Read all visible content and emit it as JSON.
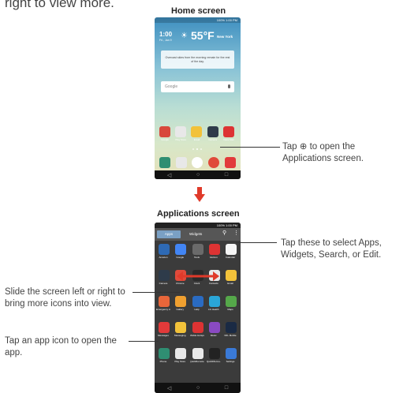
{
  "intro_text": "right to view more.",
  "home": {
    "caption": "Home screen",
    "status": "100% 1:00 PM",
    "weather": {
      "time": "1:00",
      "ampm": "PM",
      "date": "Fri., Jan 9",
      "temp": "55°F",
      "city": "New York",
      "description": "Overcast skies from the morning remain for the rest of the day."
    },
    "search_placeholder": "Google",
    "app_icons": [
      {
        "label": "Google",
        "color": "#d8483b"
      },
      {
        "label": "Play Store",
        "color": "#e8e8e8"
      },
      {
        "label": "Email",
        "color": "#f2c23a"
      },
      {
        "label": "Camera",
        "color": "#2e3b4a"
      },
      {
        "label": "Voice Mail",
        "color": "#d33"
      }
    ],
    "dock_icons": [
      {
        "label": "Phone",
        "color": "#2f8e72"
      },
      {
        "label": "Contacts",
        "color": "#e8e8e8"
      },
      {
        "label": "Apps",
        "color": "#ffffff"
      },
      {
        "label": "Chrome",
        "color": "#e04a3a"
      },
      {
        "label": "Messaging",
        "color": "#e23a3a"
      }
    ],
    "callout": "Tap ⊕ to open the Applications screen."
  },
  "apps_screen": {
    "caption": "Applications screen",
    "status": "100% 1:00 PM",
    "tab_apps": "Apps",
    "tab_widgets": "Widgets",
    "grid": [
      [
        {
          "label": "Amazon",
          "color": "#2e6ab5"
        },
        {
          "label": "Google",
          "color": "#4285f4"
        },
        {
          "label": "Tools",
          "color": "#6a6a6a"
        },
        {
          "label": "Verizon",
          "color": "#d33"
        },
        {
          "label": "Calendar",
          "color": "#f5f5f5"
        }
      ],
      [
        {
          "label": "Camera",
          "color": "#2e3b4a"
        },
        {
          "label": "Chrome",
          "color": "#e04a3a"
        },
        {
          "label": "Clock",
          "color": "#2a2a2a"
        },
        {
          "label": "Contacts",
          "color": "#e8e8e8"
        },
        {
          "label": "Email",
          "color": "#f2c23a"
        }
      ],
      [
        {
          "label": "Emergency Alerts",
          "color": "#e8663a"
        },
        {
          "label": "Gallery",
          "color": "#f0a030"
        },
        {
          "label": "Help",
          "color": "#2a6bc2"
        },
        {
          "label": "LG Health",
          "color": "#2aa6d8"
        },
        {
          "label": "Maps",
          "color": "#55a84a"
        }
      ],
      [
        {
          "label": "Messages",
          "color": "#e23a3a"
        },
        {
          "label": "Messaging",
          "color": "#f2c23a"
        },
        {
          "label": "Mobile Hotspot",
          "color": "#d33"
        },
        {
          "label": "Music",
          "color": "#8a4ac2"
        },
        {
          "label": "NFL Mobile",
          "color": "#1a2a44"
        }
      ],
      [
        {
          "label": "Phone",
          "color": "#2f8e72"
        },
        {
          "label": "Play Store",
          "color": "#e8e8e8"
        },
        {
          "label": "QuickRemote",
          "color": "#e8e8e8"
        },
        {
          "label": "QuickMemo+",
          "color": "#222"
        },
        {
          "label": "Settings",
          "color": "#3a7ad8"
        }
      ]
    ],
    "callout_tabs": "Tap these to select Apps, Widgets, Search, or Edit.",
    "callout_slide": "Slide the screen left or right to bring more icons into view.",
    "callout_tap": "Tap an app icon to open the app."
  }
}
